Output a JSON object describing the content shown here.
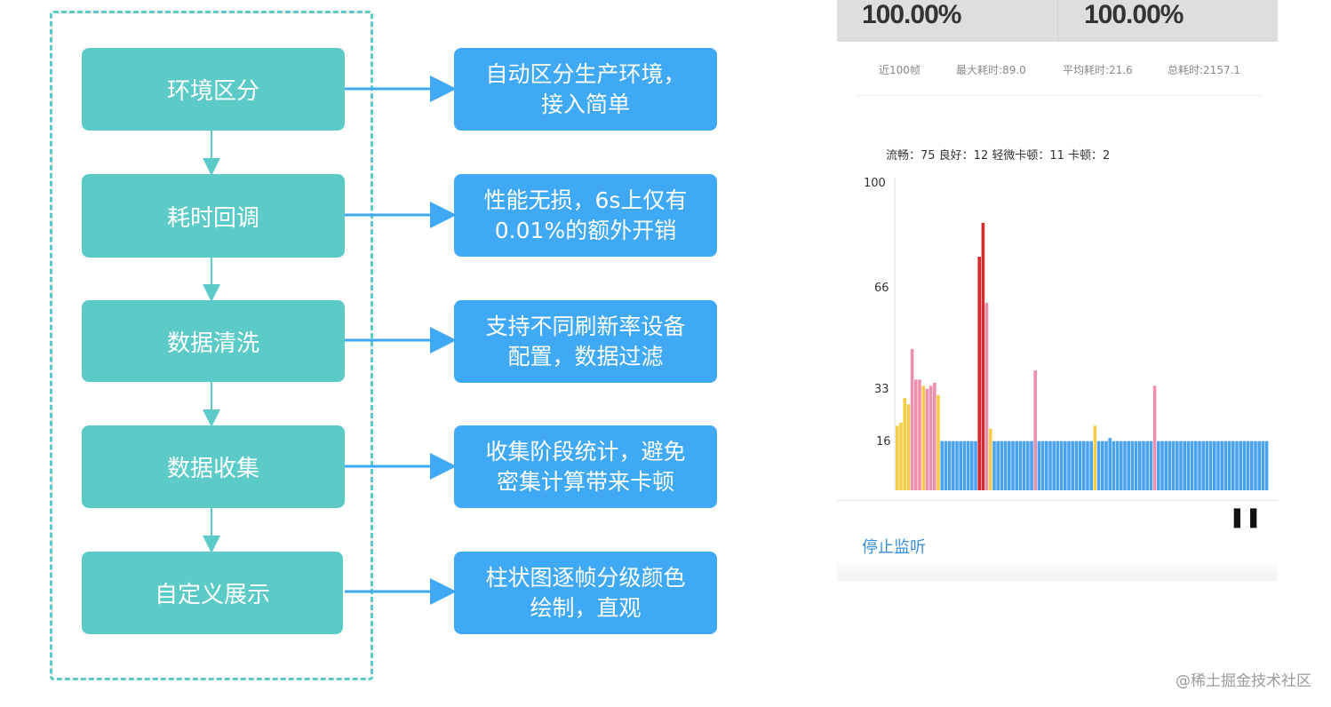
{
  "flow": {
    "steps": [
      "环境区分",
      "耗时回调",
      "数据清洗",
      "数据收集",
      "自定义展示"
    ],
    "descriptions": [
      "自动区分生产环境，\n接入简单",
      "性能无损，6s上仅有\n0.01%的额外开销",
      "支持不同刷新率设备\n配置，数据过滤",
      "收集阶段统计，避免\n密集计算带来卡顿",
      "柱状图逐帧分级颜色\n绘制，直观"
    ],
    "colors": {
      "step": "#5ccbc7",
      "desc": "#3fa9f5",
      "arrow": "#3fa9f5",
      "frame": "#5ccbc7"
    }
  },
  "monitor": {
    "top_values": [
      "100.00%",
      "100.00%"
    ],
    "stats": [
      "近100帧",
      "最大耗时:89.0",
      "平均耗时:21.6",
      "总耗时:2157.1"
    ],
    "legend": "流畅：75 良好：12 轻微卡顿：11 卡顿：2",
    "stop_label": "停止监听",
    "pause_icon": "pause-icon"
  },
  "chart_data": {
    "type": "bar",
    "yticks": [
      100,
      66,
      33,
      16
    ],
    "ylim": [
      0,
      100
    ],
    "colors": {
      "smooth": "#4aa3ef",
      "good": "#f5cd48",
      "slight": "#ee8fad",
      "jank": "#d52b2e"
    },
    "values": [
      21,
      22,
      30,
      28,
      46,
      36,
      36,
      34,
      33,
      34,
      35,
      31,
      16,
      16,
      16,
      16,
      16,
      16,
      16,
      16,
      16,
      16,
      76,
      87,
      61,
      20,
      16,
      16,
      16,
      16,
      16,
      16,
      16,
      16,
      16,
      16,
      16,
      39,
      16,
      16,
      16,
      16,
      16,
      16,
      16,
      16,
      16,
      16,
      16,
      16,
      16,
      16,
      16,
      21,
      16,
      16,
      16,
      17,
      16,
      16,
      16,
      16,
      16,
      16,
      16,
      16,
      16,
      16,
      16,
      34,
      16,
      16,
      16,
      16,
      16,
      16,
      16,
      16,
      16,
      16,
      16,
      16,
      16,
      16,
      16,
      16,
      16,
      16,
      16,
      16,
      16,
      16,
      16,
      16,
      16,
      16,
      16,
      16,
      16,
      16
    ],
    "levels": [
      "good",
      "good",
      "good",
      "good",
      "slight",
      "slight",
      "slight",
      "good",
      "slight",
      "slight",
      "slight",
      "good",
      "smooth",
      "smooth",
      "smooth",
      "smooth",
      "smooth",
      "smooth",
      "smooth",
      "smooth",
      "smooth",
      "smooth",
      "jank",
      "jank",
      "slight",
      "good",
      "smooth",
      "smooth",
      "smooth",
      "smooth",
      "smooth",
      "smooth",
      "smooth",
      "smooth",
      "smooth",
      "smooth",
      "smooth",
      "slight",
      "smooth",
      "smooth",
      "smooth",
      "smooth",
      "smooth",
      "smooth",
      "smooth",
      "smooth",
      "smooth",
      "smooth",
      "smooth",
      "smooth",
      "smooth",
      "smooth",
      "smooth",
      "good",
      "smooth",
      "smooth",
      "smooth",
      "smooth",
      "smooth",
      "smooth",
      "smooth",
      "smooth",
      "smooth",
      "smooth",
      "smooth",
      "smooth",
      "smooth",
      "smooth",
      "smooth",
      "slight",
      "smooth",
      "smooth",
      "smooth",
      "smooth",
      "smooth",
      "smooth",
      "smooth",
      "smooth",
      "smooth",
      "smooth",
      "smooth",
      "smooth",
      "smooth",
      "smooth",
      "smooth",
      "smooth",
      "smooth",
      "smooth",
      "smooth",
      "smooth",
      "smooth",
      "smooth",
      "smooth",
      "smooth",
      "smooth",
      "smooth",
      "smooth",
      "smooth",
      "smooth",
      "smooth"
    ]
  },
  "watermark": "@稀土掘金技术社区"
}
